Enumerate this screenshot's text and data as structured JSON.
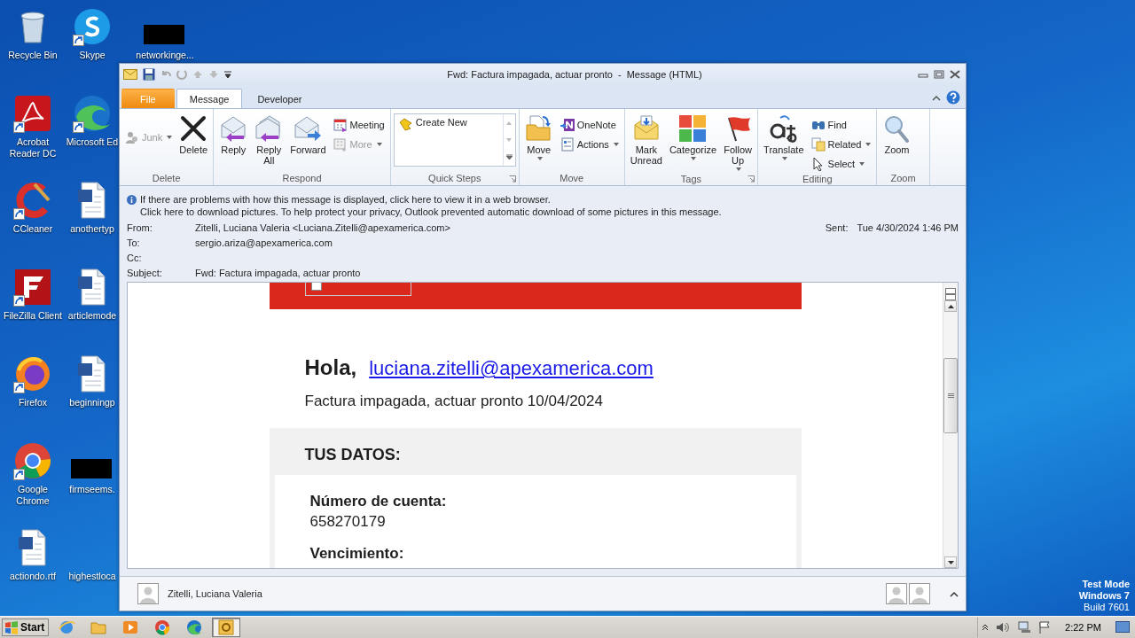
{
  "desktop": {
    "columns": [
      [
        {
          "label": "Recycle Bin",
          "shortcut": false
        },
        {
          "label": "Acrobat Reader DC",
          "shortcut": true
        },
        {
          "label": "CCleaner",
          "shortcut": true
        },
        {
          "label": "FileZilla Client",
          "shortcut": true
        },
        {
          "label": "Firefox",
          "shortcut": true
        },
        {
          "label": "Google Chrome",
          "shortcut": true
        },
        {
          "label": "actiondo.rtf",
          "shortcut": false
        }
      ],
      [
        {
          "label": "Skype",
          "shortcut": true
        },
        {
          "label": "Microsoft Ed",
          "shortcut": true
        },
        {
          "label": "anothertyp",
          "shortcut": false
        },
        {
          "label": "articlemode",
          "shortcut": false
        },
        {
          "label": "beginningp",
          "shortcut": false
        },
        {
          "label": "firmseems.",
          "shortcut": false
        },
        {
          "label": "highestloca",
          "shortcut": false
        }
      ],
      [
        {
          "label": "networkinge...",
          "shortcut": false
        }
      ]
    ],
    "system_notice": [
      "Test Mode",
      "Windows 7",
      "Build 7601"
    ]
  },
  "window": {
    "title": "Fwd: Factura impagada, actuar pronto  -  Message (HTML)",
    "tabs": [
      {
        "label": "File",
        "kind": "backstage",
        "selected": false
      },
      {
        "label": "Message",
        "kind": "tab",
        "selected": true
      },
      {
        "label": "Developer",
        "kind": "tab",
        "selected": false
      }
    ],
    "ribbon": {
      "groups": [
        {
          "label": "Delete",
          "launcher": false,
          "items": [
            {
              "kind": "stack",
              "buttons": [
                {
                  "label": "Junk",
                  "disabled": true,
                  "dropdown": true
                }
              ]
            },
            {
              "kind": "large",
              "label": "Delete",
              "dropdown": false
            }
          ]
        },
        {
          "label": "Respond",
          "launcher": false,
          "items": [
            {
              "kind": "large",
              "label": "Reply",
              "dropdown": false
            },
            {
              "kind": "large",
              "label": "Reply All",
              "dropdown": false
            },
            {
              "kind": "large",
              "label": "Forward",
              "dropdown": false
            },
            {
              "kind": "stack",
              "buttons": [
                {
                  "label": "Meeting",
                  "disabled": false,
                  "dropdown": false
                },
                {
                  "label": "More",
                  "disabled": true,
                  "dropdown": true
                }
              ]
            }
          ]
        },
        {
          "label": "Quick Steps",
          "launcher": true,
          "items": [
            {
              "kind": "gallery",
              "label": "Create New"
            }
          ]
        },
        {
          "label": "Move",
          "launcher": false,
          "items": [
            {
              "kind": "large",
              "label": "Move",
              "dropdown": true
            },
            {
              "kind": "stack",
              "buttons": [
                {
                  "label": "OneNote",
                  "disabled": false,
                  "dropdown": false
                },
                {
                  "label": "Actions",
                  "disabled": false,
                  "dropdown": true
                }
              ]
            }
          ]
        },
        {
          "label": "Tags",
          "launcher": true,
          "items": [
            {
              "kind": "large",
              "label": "Mark Unread",
              "dropdown": false
            },
            {
              "kind": "large",
              "label": "Categorize",
              "dropdown": true
            },
            {
              "kind": "large",
              "label": "Follow Up",
              "dropdown": true
            }
          ]
        },
        {
          "label": "Editing",
          "launcher": false,
          "items": [
            {
              "kind": "large",
              "label": "Translate",
              "dropdown": true
            },
            {
              "kind": "stack",
              "buttons": [
                {
                  "label": "Find",
                  "disabled": false,
                  "dropdown": false
                },
                {
                  "label": "Related",
                  "disabled": false,
                  "dropdown": true
                },
                {
                  "label": "Select",
                  "disabled": false,
                  "dropdown": true
                }
              ]
            }
          ]
        },
        {
          "label": "Zoom",
          "launcher": false,
          "items": [
            {
              "kind": "large",
              "label": "Zoom",
              "dropdown": false
            }
          ]
        }
      ]
    },
    "info_bar": [
      "If there are problems with how this message is displayed, click here to view it in a web browser.",
      "Click here to download pictures. To help protect your privacy, Outlook prevented automatic download of some pictures in this message."
    ],
    "header": {
      "fields": [
        {
          "label": "From:",
          "value": "Zitelli, Luciana Valeria <Luciana.Zitelli@apexamerica.com>"
        },
        {
          "label": "To:",
          "value": "sergio.ariza@apexamerica.com"
        },
        {
          "label": "Cc:"
        },
        {
          "label": "Subject:",
          "value": "Fwd: Factura impagada, actuar pronto"
        }
      ],
      "sent": {
        "label": "Sent:",
        "value": "Tue 4/30/2024 1:46 PM"
      }
    },
    "body": {
      "greeting": "Hola,",
      "link": "luciana.zitelli@apexamerica.com",
      "subtitle": "Factura impagada, actuar pronto 10/04/2024",
      "section_title": "TUS DATOS:",
      "fields": [
        {
          "label": "Número de cuenta:",
          "value": "658270179"
        },
        {
          "label": "Vencimiento:"
        }
      ]
    },
    "people_pane": {
      "name": "Zitelli, Luciana Valeria"
    }
  },
  "taskbar": {
    "start": "Start",
    "apps": [
      {
        "selected": false
      },
      {
        "selected": false
      },
      {
        "selected": false
      },
      {
        "selected": false
      },
      {
        "selected": false
      },
      {
        "selected": true
      }
    ],
    "clock": "2:22 PM"
  }
}
